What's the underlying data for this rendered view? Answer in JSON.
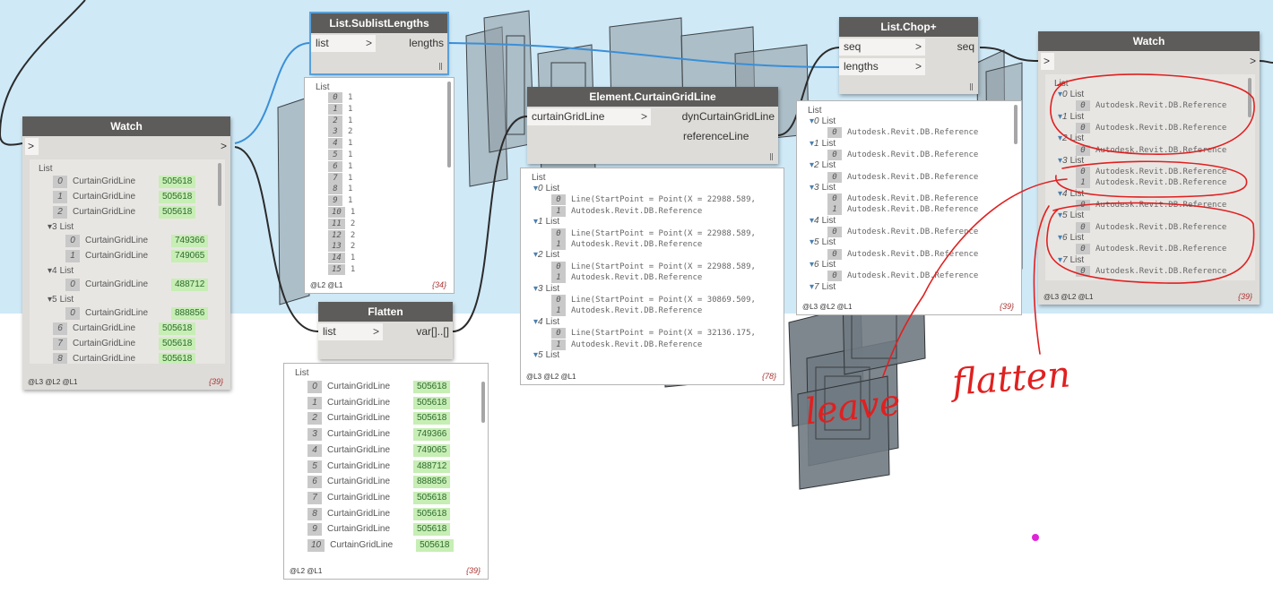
{
  "nodes": {
    "watch_left": {
      "title": "Watch",
      "in_arrow": ">",
      "out_arrow": ">",
      "list_header": "List",
      "rows": [
        {
          "idx": "0",
          "label": "CurtainGridLine",
          "value": "505618"
        },
        {
          "idx": "1",
          "label": "CurtainGridLine",
          "value": "505618"
        },
        {
          "idx": "2",
          "label": "CurtainGridLine",
          "value": "505618"
        },
        {
          "idx": "3",
          "label": "List",
          "value": ""
        },
        {
          "idx": "0",
          "label": "CurtainGridLine",
          "value": "749366"
        },
        {
          "idx": "1",
          "label": "CurtainGridLine",
          "value": "749065"
        },
        {
          "idx": "4",
          "label": "List",
          "value": ""
        },
        {
          "idx": "0",
          "label": "CurtainGridLine",
          "value": "488712"
        },
        {
          "idx": "5",
          "label": "List",
          "value": ""
        },
        {
          "idx": "0",
          "label": "CurtainGridLine",
          "value": "888856"
        },
        {
          "idx": "6",
          "label": "CurtainGridLine",
          "value": "505618"
        },
        {
          "idx": "7",
          "label": "CurtainGridLine",
          "value": "505618"
        },
        {
          "idx": "8",
          "label": "CurtainGridLine",
          "value": "505618"
        }
      ],
      "levels": "@L3 @L2 @L1",
      "count": "{39}"
    },
    "sublist_lengths": {
      "title": "List.SublistLengths",
      "in_label": "list",
      "in_arrow": ">",
      "out_label": "lengths",
      "lace": "l",
      "list_header": "List",
      "rows": [
        {
          "idx": "0",
          "value": "1"
        },
        {
          "idx": "1",
          "value": "1"
        },
        {
          "idx": "2",
          "value": "1"
        },
        {
          "idx": "3",
          "value": "2"
        },
        {
          "idx": "4",
          "value": "1"
        },
        {
          "idx": "5",
          "value": "1"
        },
        {
          "idx": "6",
          "value": "1"
        },
        {
          "idx": "7",
          "value": "1"
        },
        {
          "idx": "8",
          "value": "1"
        },
        {
          "idx": "9",
          "value": "1"
        },
        {
          "idx": "10",
          "value": "1"
        },
        {
          "idx": "11",
          "value": "2"
        },
        {
          "idx": "12",
          "value": "2"
        },
        {
          "idx": "13",
          "value": "2"
        },
        {
          "idx": "14",
          "value": "1"
        },
        {
          "idx": "15",
          "value": "1"
        }
      ],
      "levels": "@L2 @L1",
      "count": "{34}"
    },
    "flatten": {
      "title": "Flatten",
      "in_label": "list",
      "in_arrow": ">",
      "out_label": "var[]..[]",
      "list_header": "List",
      "rows": [
        {
          "idx": "0",
          "label": "CurtainGridLine",
          "value": "505618"
        },
        {
          "idx": "1",
          "label": "CurtainGridLine",
          "value": "505618"
        },
        {
          "idx": "2",
          "label": "CurtainGridLine",
          "value": "505618"
        },
        {
          "idx": "3",
          "label": "CurtainGridLine",
          "value": "749366"
        },
        {
          "idx": "4",
          "label": "CurtainGridLine",
          "value": "749065"
        },
        {
          "idx": "5",
          "label": "CurtainGridLine",
          "value": "488712"
        },
        {
          "idx": "6",
          "label": "CurtainGridLine",
          "value": "888856"
        },
        {
          "idx": "7",
          "label": "CurtainGridLine",
          "value": "505618"
        },
        {
          "idx": "8",
          "label": "CurtainGridLine",
          "value": "505618"
        },
        {
          "idx": "9",
          "label": "CurtainGridLine",
          "value": "505618"
        },
        {
          "idx": "10",
          "label": "CurtainGridLine",
          "value": "505618"
        }
      ],
      "levels": "@L2 @L1",
      "count": "{39}"
    },
    "curtain_grid_line": {
      "title": "Element.CurtainGridLine",
      "in_label": "curtainGridLine",
      "in_arrow": ">",
      "out_1": "dynCurtainGridLine",
      "out_2": "referenceLine",
      "lace": "l",
      "list_header": "List",
      "rows": [
        {
          "kind": "list",
          "idx": "0",
          "text": "List"
        },
        {
          "kind": "item",
          "idx": "0",
          "text": "Line(StartPoint = Point(X = 22988.589,"
        },
        {
          "kind": "item",
          "idx": "1",
          "text": "Autodesk.Revit.DB.Reference"
        },
        {
          "kind": "list",
          "idx": "1",
          "text": "List"
        },
        {
          "kind": "item",
          "idx": "0",
          "text": "Line(StartPoint = Point(X = 22988.589,"
        },
        {
          "kind": "item",
          "idx": "1",
          "text": "Autodesk.Revit.DB.Reference"
        },
        {
          "kind": "list",
          "idx": "2",
          "text": "List"
        },
        {
          "kind": "item",
          "idx": "0",
          "text": "Line(StartPoint = Point(X = 22988.589,"
        },
        {
          "kind": "item",
          "idx": "1",
          "text": "Autodesk.Revit.DB.Reference"
        },
        {
          "kind": "list",
          "idx": "3",
          "text": "List"
        },
        {
          "kind": "item",
          "idx": "0",
          "text": "Line(StartPoint = Point(X = 30869.509,"
        },
        {
          "kind": "item",
          "idx": "1",
          "text": "Autodesk.Revit.DB.Reference"
        },
        {
          "kind": "list",
          "idx": "4",
          "text": "List"
        },
        {
          "kind": "item",
          "idx": "0",
          "text": "Line(StartPoint = Point(X = 32136.175,"
        },
        {
          "kind": "item",
          "idx": "1",
          "text": "Autodesk.Revit.DB.Reference"
        },
        {
          "kind": "list",
          "idx": "5",
          "text": "List"
        }
      ],
      "levels": "@L3 @L2 @L1",
      "count": "{78}"
    },
    "chop": {
      "title": "List.Chop+",
      "in_1": "seq",
      "in_2": "lengths",
      "in_arrow": ">",
      "out_label": "seq",
      "lace": "l",
      "list_header": "List",
      "rows": [
        {
          "kind": "list",
          "idx": "0",
          "text": "List"
        },
        {
          "kind": "item",
          "idx": "0",
          "text": "Autodesk.Revit.DB.Reference"
        },
        {
          "kind": "list",
          "idx": "1",
          "text": "List"
        },
        {
          "kind": "item",
          "idx": "0",
          "text": "Autodesk.Revit.DB.Reference"
        },
        {
          "kind": "list",
          "idx": "2",
          "text": "List"
        },
        {
          "kind": "item",
          "idx": "0",
          "text": "Autodesk.Revit.DB.Reference"
        },
        {
          "kind": "list",
          "idx": "3",
          "text": "List"
        },
        {
          "kind": "item",
          "idx": "0",
          "text": "Autodesk.Revit.DB.Reference"
        },
        {
          "kind": "item",
          "idx": "1",
          "text": "Autodesk.Revit.DB.Reference"
        },
        {
          "kind": "list",
          "idx": "4",
          "text": "List"
        },
        {
          "kind": "item",
          "idx": "0",
          "text": "Autodesk.Revit.DB.Reference"
        },
        {
          "kind": "list",
          "idx": "5",
          "text": "List"
        },
        {
          "kind": "item",
          "idx": "0",
          "text": "Autodesk.Revit.DB.Reference"
        },
        {
          "kind": "list",
          "idx": "6",
          "text": "List"
        },
        {
          "kind": "item",
          "idx": "0",
          "text": "Autodesk.Revit.DB.Reference"
        },
        {
          "kind": "list",
          "idx": "7",
          "text": "List"
        }
      ],
      "levels": "@L3 @L2 @L1",
      "count": "{39}"
    },
    "watch_right": {
      "title": "Watch",
      "in_arrow": ">",
      "out_arrow": ">",
      "list_header": "List",
      "rows": [
        {
          "kind": "list",
          "idx": "0",
          "text": "List"
        },
        {
          "kind": "item",
          "idx": "0",
          "text": "Autodesk.Revit.DB.Reference"
        },
        {
          "kind": "list",
          "idx": "1",
          "text": "List"
        },
        {
          "kind": "item",
          "idx": "0",
          "text": "Autodesk.Revit.DB.Reference"
        },
        {
          "kind": "list",
          "idx": "2",
          "text": "List"
        },
        {
          "kind": "item",
          "idx": "0",
          "text": "Autodesk.Revit.DB.Reference"
        },
        {
          "kind": "list",
          "idx": "3",
          "text": "List"
        },
        {
          "kind": "item",
          "idx": "0",
          "text": "Autodesk.Revit.DB.Reference"
        },
        {
          "kind": "item",
          "idx": "1",
          "text": "Autodesk.Revit.DB.Reference"
        },
        {
          "kind": "list",
          "idx": "4",
          "text": "List"
        },
        {
          "kind": "item",
          "idx": "0",
          "text": "Autodesk.Revit.DB.Reference"
        },
        {
          "kind": "list",
          "idx": "5",
          "text": "List"
        },
        {
          "kind": "item",
          "idx": "0",
          "text": "Autodesk.Revit.DB.Reference"
        },
        {
          "kind": "list",
          "idx": "6",
          "text": "List"
        },
        {
          "kind": "item",
          "idx": "0",
          "text": "Autodesk.Revit.DB.Reference"
        },
        {
          "kind": "list",
          "idx": "7",
          "text": "List"
        },
        {
          "kind": "item",
          "idx": "0",
          "text": "Autodesk.Revit.DB.Reference"
        }
      ],
      "levels": "@L3 @L2 @L1",
      "count": "{39}"
    }
  },
  "annotations": {
    "leave": "leave",
    "flatten": "flatten"
  },
  "colors": {
    "wire_selected": "#3a8fd6",
    "wire_default": "#2b2b2b",
    "annotation": "#e02020"
  }
}
